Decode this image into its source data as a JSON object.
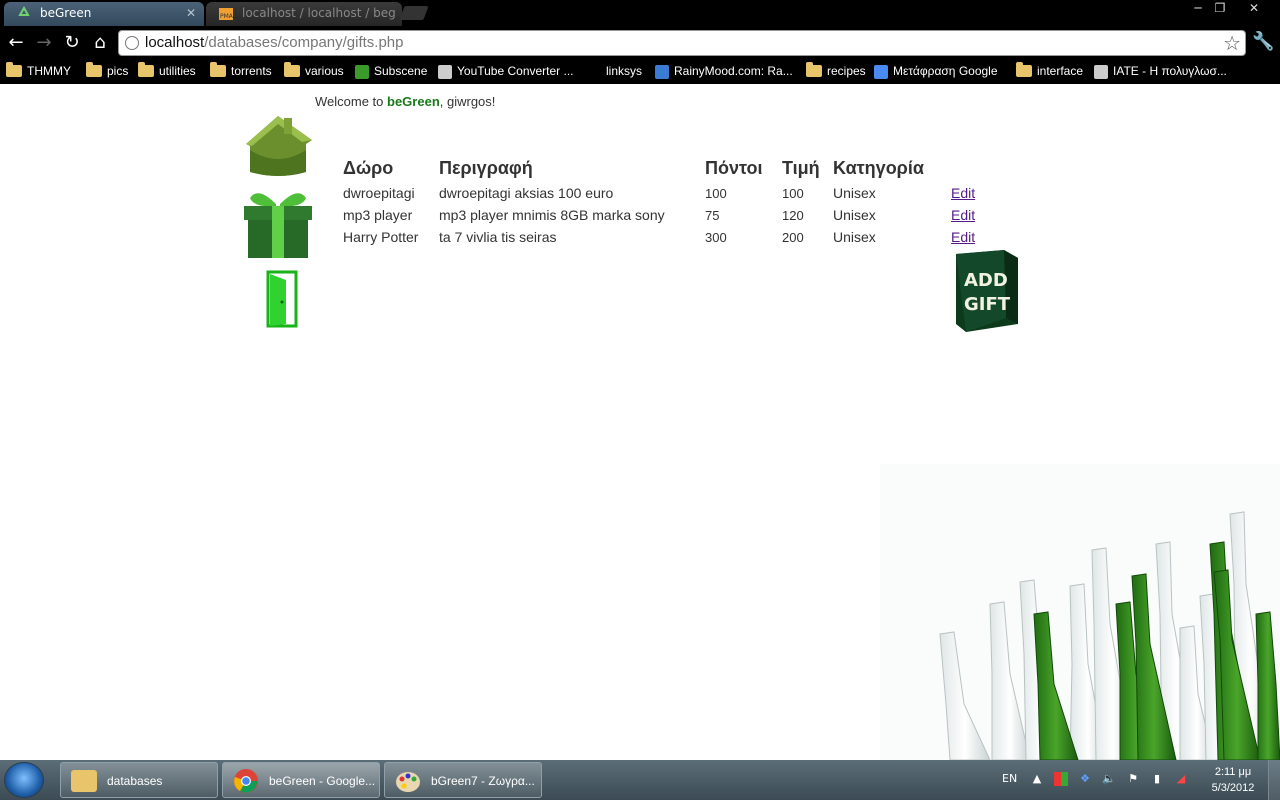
{
  "browser": {
    "tabs": [
      {
        "title": "beGreen",
        "active": true
      },
      {
        "title": "localhost / localhost / beg",
        "active": false
      }
    ],
    "url": {
      "host": "localhost",
      "path": "/databases/company/gifts.php"
    },
    "window_controls": {
      "minimize": "─",
      "maximize": "❐",
      "close": "✕"
    },
    "bookmarks": [
      {
        "label": "THMMY",
        "icon": "folder-icon"
      },
      {
        "label": "pics",
        "icon": "folder-icon"
      },
      {
        "label": "utilities",
        "icon": "folder-icon"
      },
      {
        "label": "torrents",
        "icon": "folder-icon"
      },
      {
        "label": "various",
        "icon": "folder-icon"
      },
      {
        "label": "Subscene",
        "icon": "subscene-icon"
      },
      {
        "label": "YouTube Converter ...",
        "icon": "converter-icon"
      },
      {
        "label": "linksys",
        "icon": ""
      },
      {
        "label": "RainyMood.com: Ra...",
        "icon": "raindrop-icon"
      },
      {
        "label": "recipes",
        "icon": "folder-icon"
      },
      {
        "label": "Μετάφραση Google",
        "icon": "google-translate-icon"
      },
      {
        "label": "interface",
        "icon": "folder-icon"
      },
      {
        "label": "IATE - Η πολυγλωσ...",
        "icon": "iate-icon"
      }
    ]
  },
  "page": {
    "welcome": {
      "prefix": "Welcome to ",
      "brand": "beGreen",
      "suffix": ", giwrgos!"
    },
    "table": {
      "headers": [
        "Δώρο",
        "Περιγραφή",
        "Πόντοι",
        "Τιμή",
        "Κατηγορία"
      ],
      "rows": [
        {
          "gift": "dwroepitagi",
          "description": "dwroepitagi aksias 100 euro",
          "points": "100",
          "price": "100",
          "category": "Unisex",
          "action": "Edit"
        },
        {
          "gift": "mp3 player",
          "description": "mp3 player mnimis 8GB marka sony",
          "points": "75",
          "price": "120",
          "category": "Unisex",
          "action": "Edit"
        },
        {
          "gift": "Harry Potter",
          "description": "ta 7 vivlia tis seiras",
          "points": "300",
          "price": "200",
          "category": "Unisex",
          "action": "Edit"
        }
      ]
    },
    "add_gift": {
      "line1": "ADD",
      "line2": "GIFT"
    }
  },
  "taskbar": {
    "items": [
      {
        "label": "databases",
        "icon": "folder-icon"
      },
      {
        "label": "beGreen - Google...",
        "icon": "chrome-icon"
      },
      {
        "label": "bGreen7 - Ζωγρα...",
        "icon": "paint-icon"
      }
    ],
    "language": "EN",
    "clock": {
      "time": "2:11 μμ",
      "date": "5/3/2012"
    }
  },
  "colors": {
    "brand_green": "#1a7a1a",
    "link_visited": "#551a8b"
  }
}
